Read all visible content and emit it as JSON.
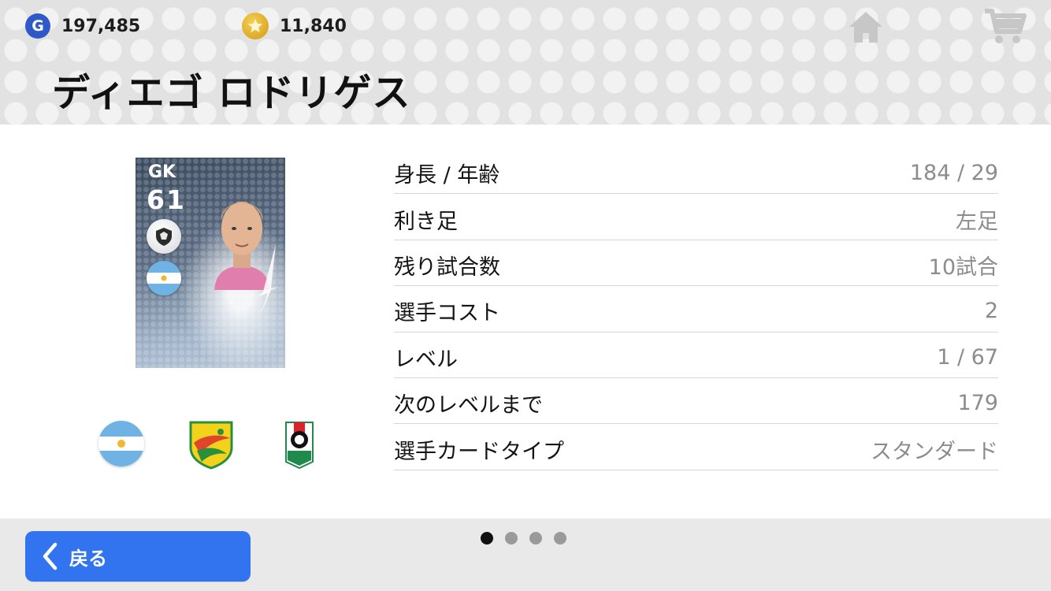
{
  "header": {
    "gp": {
      "icon": "gp-coin-icon",
      "icon_letter": "G",
      "amount": "197,485"
    },
    "coins": {
      "icon": "star-coin-icon",
      "amount": "11,840"
    },
    "player_name": "ディエゴ ロドリゲス"
  },
  "card": {
    "position": "GK",
    "rating": "61"
  },
  "stats": [
    {
      "label": "身長 / 年齢",
      "value": "184 / 29"
    },
    {
      "label": "利き足",
      "value": "左足"
    },
    {
      "label": "残り試合数",
      "value": "10試合"
    },
    {
      "label": "選手コスト",
      "value": "2"
    },
    {
      "label": "レベル",
      "value": "1 / 67"
    },
    {
      "label": "次のレベルまで",
      "value": "179"
    },
    {
      "label": "選手カードタイプ",
      "value": "スタンダード"
    }
  ],
  "footer": {
    "back_label": "戻る",
    "pager_count": 4,
    "pager_active": 1
  },
  "colors": {
    "accent_button": "#3274f0",
    "gp_coin": "#2f59c9",
    "star_coin": "#e2b432",
    "value_text": "#8c8c8c"
  }
}
